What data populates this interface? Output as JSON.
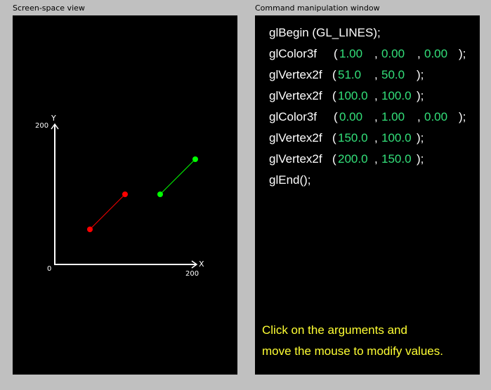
{
  "screen_view": {
    "title": "Screen-space view",
    "axis": {
      "y_label": "Y",
      "x_label": "X",
      "y_max_label": "200",
      "x_max_label": "200",
      "origin_label": "0"
    }
  },
  "command_window": {
    "title": "Command manipulation window",
    "lines": [
      {
        "parts": [
          "glBegin (GL_LINES);"
        ]
      },
      {
        "parts": [
          "glColor3f",
          "(",
          "1.00",
          ",",
          "0.00",
          ",",
          "0.00",
          ");"
        ]
      },
      {
        "parts": [
          "glVertex2f",
          "(",
          "51.0",
          ",",
          "50.0",
          ");"
        ]
      },
      {
        "parts": [
          "glVertex2f",
          "(",
          "100.0",
          ",",
          "100.0",
          ");"
        ]
      },
      {
        "parts": [
          "glColor3f",
          "(",
          "0.00",
          ",",
          "1.00",
          ",",
          "0.00",
          ");"
        ]
      },
      {
        "parts": [
          "glVertex2f",
          "(",
          "150.0",
          ",",
          "100.0",
          ");"
        ]
      },
      {
        "parts": [
          "glVertex2f",
          "(",
          "200.0",
          ",",
          "150.0",
          ");"
        ]
      },
      {
        "parts": [
          "glEnd();"
        ]
      }
    ],
    "hint_line1": "Click on the arguments and",
    "hint_line2": "move the mouse to modify values."
  },
  "colors": {
    "background": "#c0c0c0",
    "panel": "#000000",
    "argument": "#33e07a",
    "hint": "#ffff33",
    "line1": "#ff0000",
    "line2": "#00ff00"
  }
}
